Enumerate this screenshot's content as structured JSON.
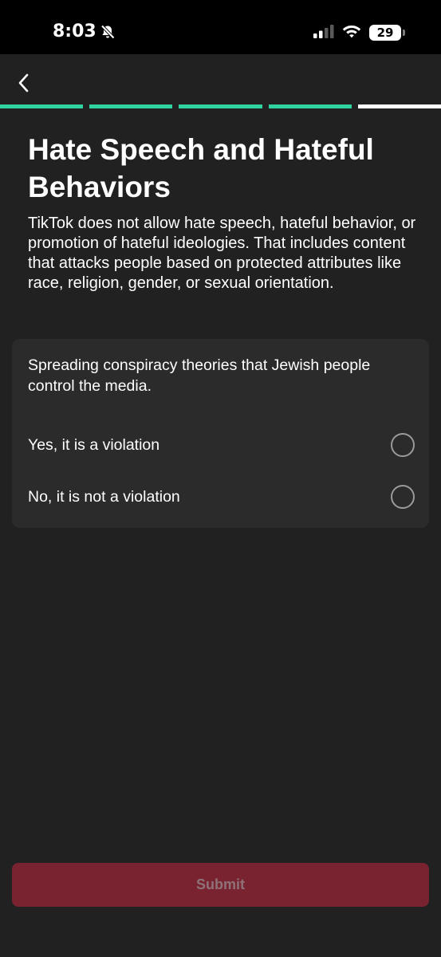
{
  "status_bar": {
    "time": "8:03",
    "battery": "29",
    "icons": [
      "bell-slash-icon",
      "signal-icon",
      "wifi-icon",
      "battery-icon"
    ]
  },
  "nav": {
    "back_icon": "chevron-left-icon"
  },
  "progress": {
    "total_steps": 5,
    "completed_steps": 4,
    "colors": {
      "done": "#2ed3a0",
      "current": "#ffffff"
    }
  },
  "page": {
    "title": "Hate Speech and Hateful Behaviors",
    "description": "TikTok does not allow hate speech, hateful behavior, or promotion of hateful ideologies. That includes content that attacks people based on protected attributes like race, religion, gender, or sexual orientation."
  },
  "question": {
    "text": "Spreading conspiracy theories that Jewish people control the media.",
    "options": [
      {
        "label": "Yes, it is a violation",
        "selected": false
      },
      {
        "label": "No, it is not a violation",
        "selected": false
      }
    ]
  },
  "submit": {
    "label": "Submit",
    "enabled": false,
    "background": "#792331"
  }
}
